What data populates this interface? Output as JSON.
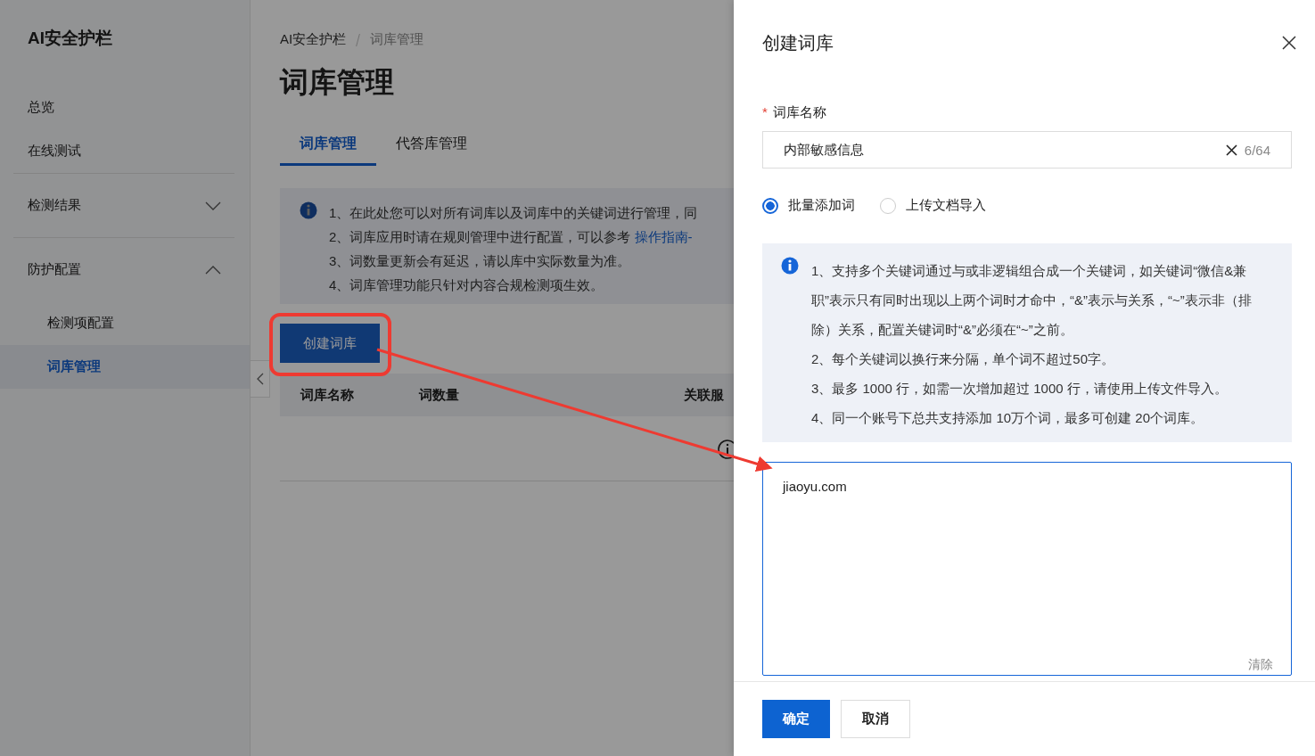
{
  "sidebar": {
    "title": "AI安全护栏",
    "items": [
      {
        "label": "总览",
        "kind": "link",
        "selected": false
      },
      {
        "label": "在线测试",
        "kind": "link",
        "selected": false
      },
      {
        "label": "检测结果",
        "kind": "group",
        "expanded": false
      },
      {
        "label": "防护配置",
        "kind": "group",
        "expanded": true,
        "children": [
          {
            "label": "检测项配置",
            "selected": false
          },
          {
            "label": "词库管理",
            "selected": true
          }
        ]
      }
    ]
  },
  "breadcrumb": [
    "AI安全护栏",
    "词库管理"
  ],
  "page_title": "词库管理",
  "tabs": [
    {
      "label": "词库管理",
      "selected": true
    },
    {
      "label": "代答库管理",
      "selected": false
    }
  ],
  "notice": [
    {
      "text": "1、在此处您可以对所有词库以及词库中的关键词进行管理，同"
    },
    {
      "text": "2、词库应用时请在规则管理中进行配置，可以参考 ",
      "link": "操作指南-"
    },
    {
      "text": "3、词数量更新会有延迟，请以库中实际数量为准。"
    },
    {
      "text": "4、词库管理功能只针对内容合规检测项生效。"
    }
  ],
  "create_button": "创建词库",
  "table": {
    "columns": [
      "词库名称",
      "词数量",
      "关联服"
    ]
  },
  "drawer": {
    "title": "创建词库",
    "name_field": {
      "label": "词库名称",
      "required": true,
      "required_mark": "*",
      "value": "内部敏感信息",
      "counter": "6/64"
    },
    "mode_options": [
      {
        "label": "批量添加词",
        "selected": true
      },
      {
        "label": "上传文档导入",
        "selected": false
      }
    ],
    "tips": [
      "1、支持多个关键词通过与或非逻辑组合成一个关键词，如关键词“微信&兼职”表示只有同时出现以上两个词时才命中，“&”表示与关系，“~”表示非（排除）关系，配置关键词时“&”必须在“~”之前。",
      "2、每个关键词以换行来分隔，单个词不超过50字。",
      "3、最多 1000 行，如需一次增加超过 1000 行，请使用上传文件导入。",
      "4、同一个账号下总共支持添加 10万个词，最多可创建 20个词库。"
    ],
    "keywords_field": {
      "value": "jiaoyu.com",
      "clear": "清除"
    },
    "buttons": [
      {
        "label": "确定",
        "kind": "primary"
      },
      {
        "label": "取消",
        "kind": "default"
      }
    ]
  }
}
